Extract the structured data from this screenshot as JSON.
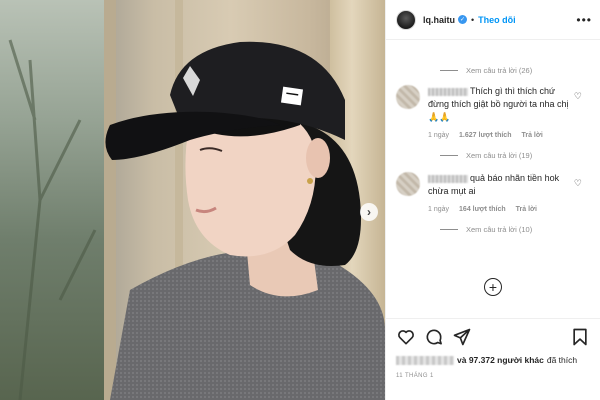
{
  "header": {
    "username": "lq.haitu",
    "separator": "•",
    "follow_label": "Theo dõi",
    "more_label": "•••"
  },
  "comments": {
    "view_replies_1": "Xem câu trả lời (26)",
    "comment_1": {
      "text": "Thích gì thì thích chứ đừng thích giật bồ người ta nha chị 🙏🙏",
      "time": "1 ngày",
      "likes": "1.627 lượt thích",
      "reply": "Trả lời"
    },
    "view_replies_2": "Xem câu trả lời (19)",
    "comment_2": {
      "text": "quả báo nhãn tiền hok chừa mụt ai",
      "time": "1 ngày",
      "likes": "164 lượt thích",
      "reply": "Trả lời"
    },
    "view_replies_3": "Xem câu trả lời (10)",
    "heart_glyph": "♡",
    "plus_glyph": "+"
  },
  "footer": {
    "likes_bold": "và 97.372 người khác",
    "likes_rest": "đã thích",
    "date": "11 THÁNG 1"
  },
  "icons": [
    "heart-icon",
    "comment-icon",
    "share-icon",
    "bookmark-icon",
    "verified-icon",
    "chevron-right-icon",
    "add-comment-icon"
  ],
  "colors": {
    "accent": "#0095f6",
    "verified": "#3897f0",
    "muted": "#8e8e8e"
  }
}
